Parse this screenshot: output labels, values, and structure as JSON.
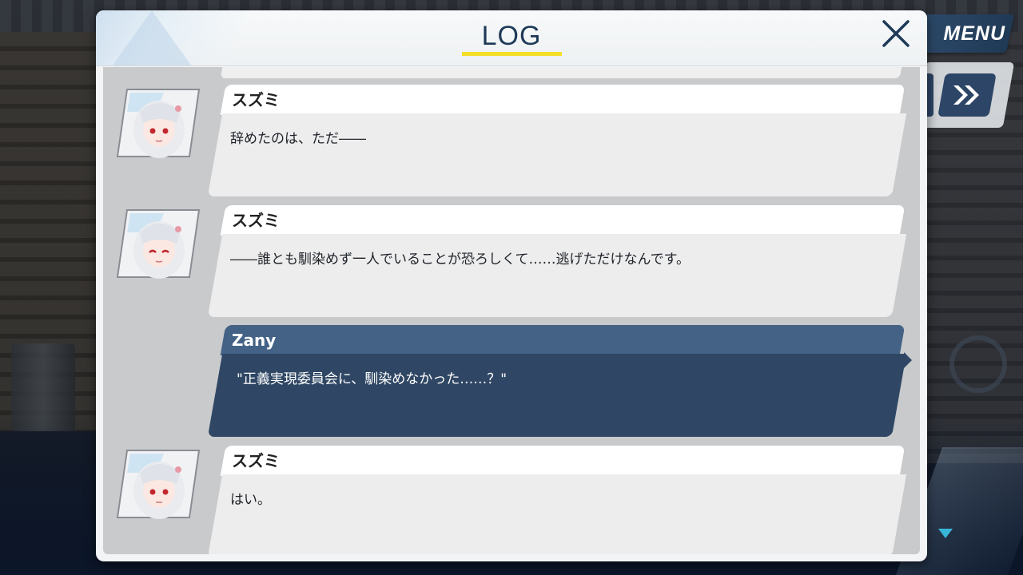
{
  "menu": {
    "label": "MENU"
  },
  "controls": {
    "fast_forward_icon": "double-chevron-right-icon",
    "scroll_indicator_icon": "triangle-down-icon"
  },
  "dialog": {
    "title": "LOG",
    "close_icon": "close-icon"
  },
  "colors": {
    "title_underline": "#f3df2a",
    "player_name_bar": "#436285",
    "player_text_box": "#2f4764",
    "npc_name_bar": "#ffffff",
    "npc_text_box": "#ededee",
    "menu_button": "#2d4a6a"
  },
  "log": [
    {
      "speaker": "スズミ",
      "text": "辞めたのは、ただ――",
      "is_player": false,
      "avatar": "character-portrait-suzumi"
    },
    {
      "speaker": "スズミ",
      "text": "――誰とも馴染めず一人でいることが恐ろしくて……逃げただけなんです。",
      "is_player": false,
      "avatar": "character-portrait-suzumi"
    },
    {
      "speaker": "Zany",
      "text": "\"正義実現委員会に、馴染めなかった……？\"",
      "is_player": true
    },
    {
      "speaker": "スズミ",
      "text": "はい。",
      "is_player": false,
      "avatar": "character-portrait-suzumi"
    }
  ]
}
